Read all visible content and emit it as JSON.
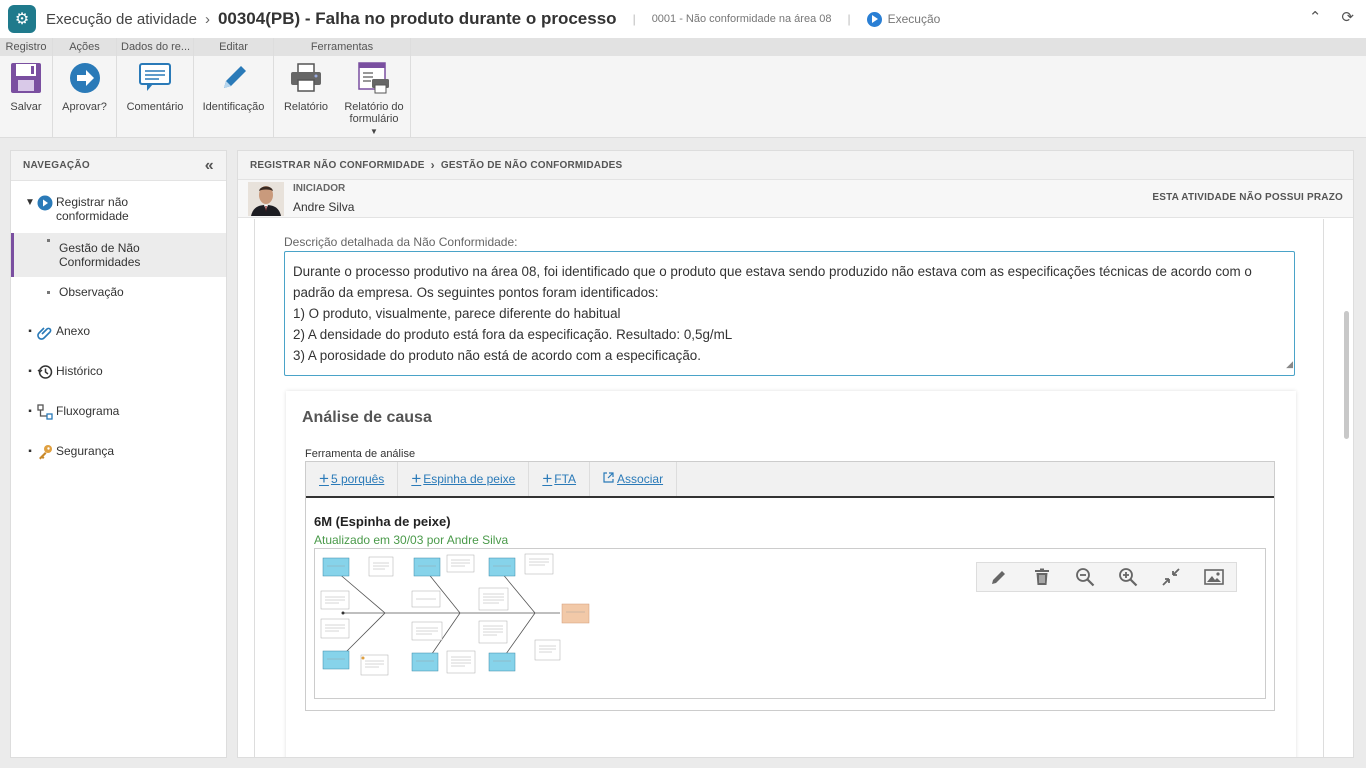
{
  "header": {
    "module": "Execução de atividade",
    "title": "00304(PB) - Falha no produto durante o processo",
    "subtitle": "0001 - Não conformidade na área 08",
    "status": "Execução"
  },
  "ribbon": {
    "groups": [
      {
        "title": "Registro",
        "buttons": [
          "Salvar"
        ]
      },
      {
        "title": "Ações",
        "buttons": [
          "Aprovar?"
        ]
      },
      {
        "title": "Dados do re...",
        "buttons": [
          "Comentário"
        ]
      },
      {
        "title": "Editar",
        "buttons": [
          "Identificação"
        ]
      },
      {
        "title": "Ferramentas",
        "buttons": [
          "Relatório",
          "Relatório do formulário"
        ]
      }
    ]
  },
  "nav": {
    "title": "NAVEGAÇÃO",
    "items": {
      "registrar": "Registrar não conformidade",
      "gestao": "Gestão de Não Conformidades",
      "observacao": "Observação",
      "anexo": "Anexo",
      "historico": "Histórico",
      "fluxograma": "Fluxograma",
      "seguranca": "Segurança"
    }
  },
  "breadcrumb": {
    "first": "REGISTRAR NÃO CONFORMIDADE",
    "second": "GESTÃO DE NÃO CONFORMIDADES"
  },
  "initiator": {
    "label": "INICIADOR",
    "name": "Andre Silva",
    "deadline": "ESTA ATIVIDADE NÃO POSSUI PRAZO"
  },
  "description": {
    "label": "Descrição detalhada da Não Conformidade:",
    "lines": [
      "Durante o processo produtivo na área 08, foi identificado que o produto que estava sendo produzido não estava com as especificações técnicas de acordo com o padrão da empresa. Os seguintes pontos foram identificados:",
      "1) O produto, visualmente, parece diferente do habitual",
      "2) A densidade do produto está fora da especificação. Resultado: 0,5g/mL",
      "3) A porosidade do produto não está de acordo com a especificação."
    ]
  },
  "cause": {
    "title": "Análise de causa",
    "tool_label": "Ferramenta de análise",
    "tabs": [
      "5 porquês",
      "Espinha de peixe",
      "FTA",
      "Associar"
    ],
    "diagram_title": "6M (Espinha de peixe)",
    "diagram_updated": "Atualizado em 30/03 por Andre Silva"
  },
  "colors": {
    "accent": "#2a7ab8",
    "nav_active": "#7a4fa0",
    "updated_text": "#4a9a4a",
    "diagram_box": "#86d3ea",
    "diagram_effect": "#f2c9a8"
  }
}
